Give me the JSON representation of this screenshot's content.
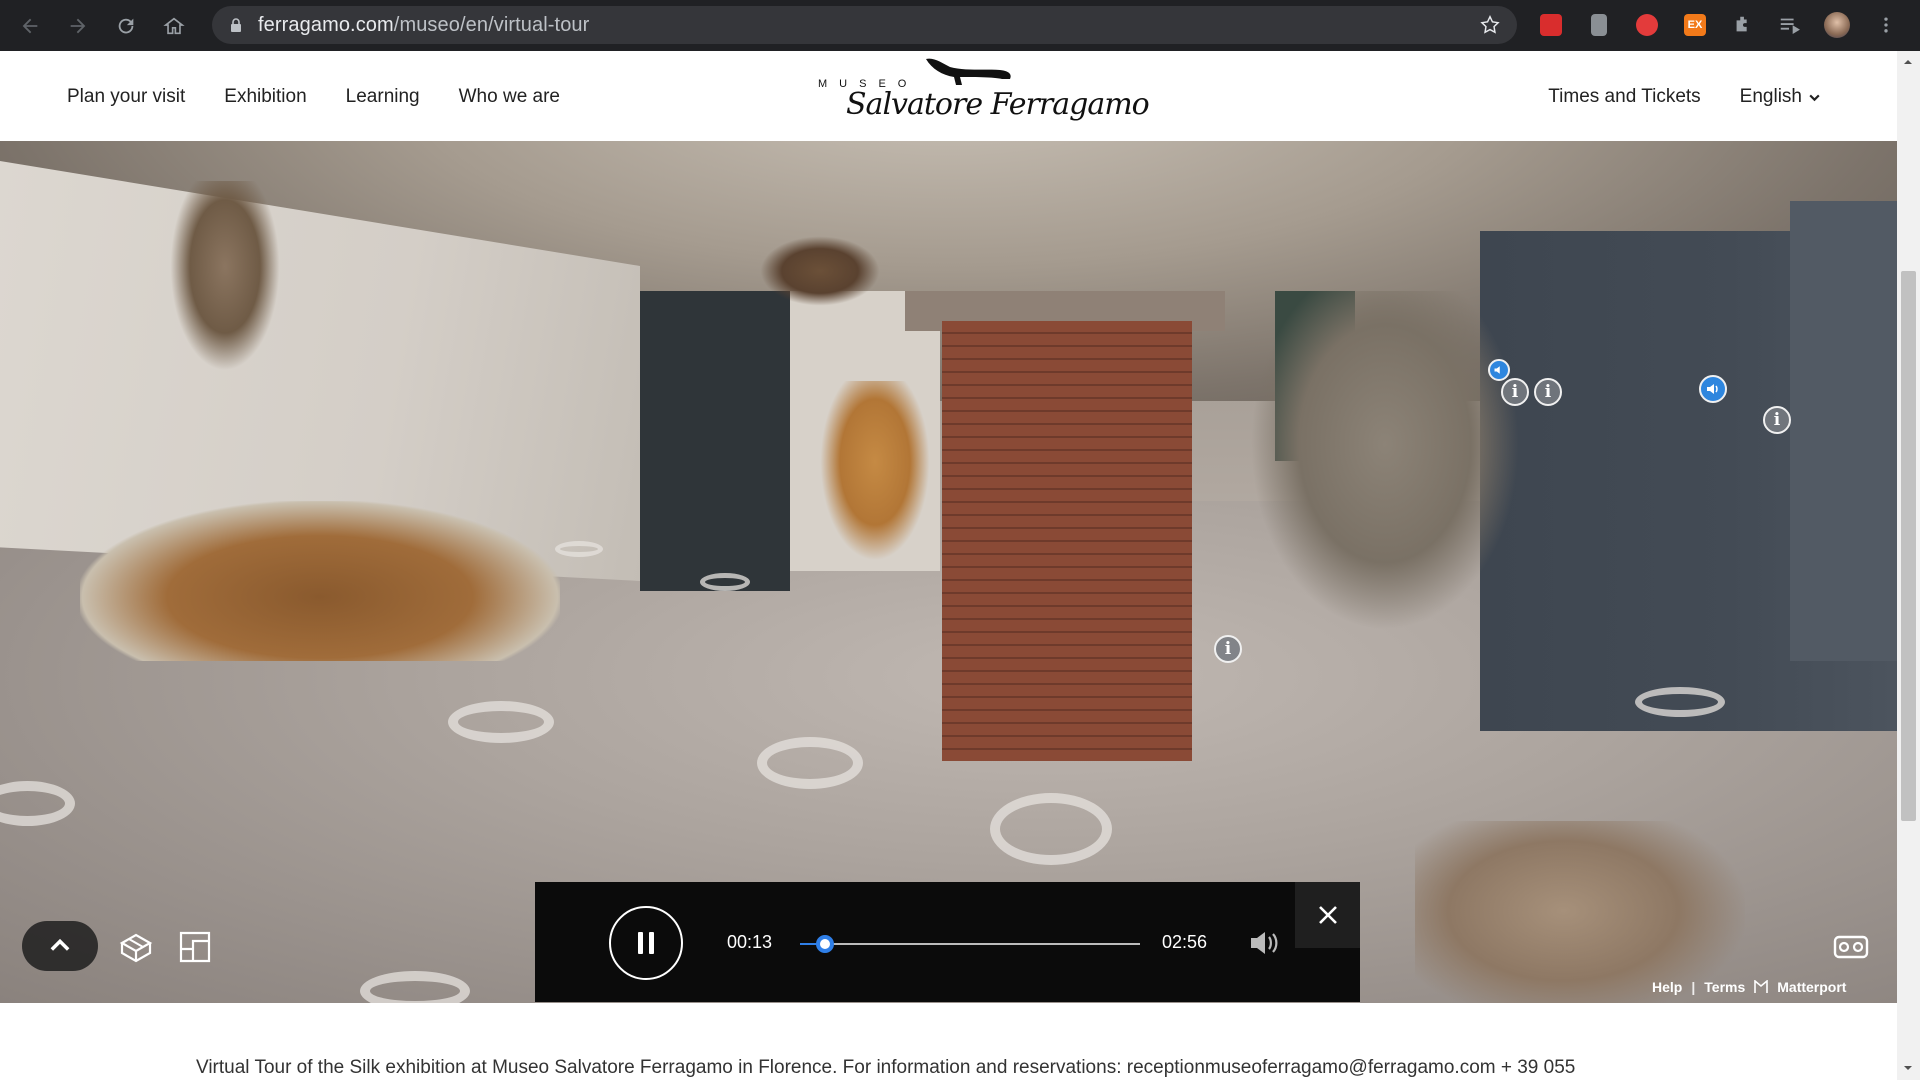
{
  "browser": {
    "url_domain": "ferragamo.com",
    "url_path": "/museo/en/virtual-tour",
    "extension_ex_label": "EX"
  },
  "header": {
    "nav": [
      {
        "label": "Plan your visit"
      },
      {
        "label": "Exhibition"
      },
      {
        "label": "Learning"
      },
      {
        "label": "Who we are"
      }
    ],
    "logo_top": "MUSEO",
    "logo_script": "Salvatore Ferragamo",
    "tickets_label": "Times and Tickets",
    "language_label": "English"
  },
  "player": {
    "current_time": "00:13",
    "total_time": "02:56",
    "progress": 0.074
  },
  "viewer": {
    "footer_links": {
      "help": "Help",
      "separator": "|",
      "terms": "Terms",
      "brand": "Matterport"
    }
  },
  "caption": "Virtual Tour of the Silk exhibition at Museo Salvatore Ferragamo in Florence. For information and reservations: receptionmuseoferragamo@ferragamo.com + 39 055",
  "colors": {
    "accent_blue": "#2f7fe8",
    "chrome_bg": "#202124",
    "player_bg": "#0b0b0b"
  },
  "icons": [
    "back-icon",
    "forward-icon",
    "reload-icon",
    "home-icon",
    "lock-icon",
    "star-icon",
    "pause-icon",
    "volume-icon",
    "close-icon",
    "chevron-up-icon",
    "dollhouse-icon",
    "floorplan-icon",
    "vr-headset-icon",
    "info-icon",
    "audio-hotspot-icon"
  ]
}
